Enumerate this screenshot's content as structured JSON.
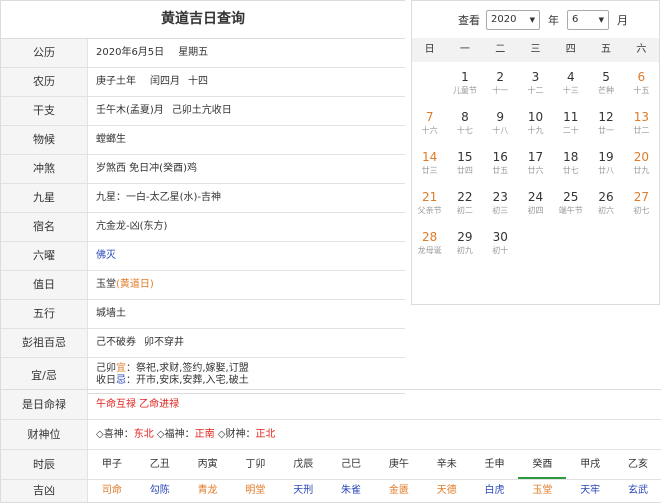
{
  "title": "黄道吉日查询",
  "rows": [
    {
      "label": "公历",
      "parts": [
        "2020年6月5日",
        "星期五"
      ]
    },
    {
      "label": "农历",
      "parts": [
        "庚子土年",
        "闰四月",
        "十四"
      ]
    },
    {
      "label": "干支",
      "parts": [
        "壬午木(孟夏)月",
        "己卯土亢收日"
      ]
    },
    {
      "label": "物候",
      "parts": [
        "螳螂生"
      ]
    },
    {
      "label": "冲煞",
      "parts": [
        "岁煞西 免日冲(癸酉)鸡"
      ]
    },
    {
      "label": "九星",
      "parts": [
        "九星：一白-太乙星(水)-吉神"
      ]
    },
    {
      "label": "宿名",
      "parts": [
        "亢金龙-凶(东方)"
      ]
    },
    {
      "label": "六曜",
      "parts": [
        "佛灭"
      ]
    },
    {
      "label": "值日",
      "parts": [
        "玉堂",
        "(黄道日)"
      ]
    },
    {
      "label": "五行",
      "parts": [
        "城墙土"
      ]
    },
    {
      "label": "彭祖百忌",
      "parts": [
        "己不破券",
        "卯不穿井"
      ]
    }
  ],
  "yiji": {
    "label": "宜/忌",
    "yi_prefix": "己卯",
    "yi_char": "宜",
    "yi_text": "：祭祀,求财,签约,嫁娶,订盟",
    "ji_prefix": "收日",
    "ji_char": "忌",
    "ji_text": "：开市,安床,安葬,入宅,破土"
  },
  "mingl": {
    "label": "是日命禄",
    "text": "午命互禄 乙命进禄"
  },
  "caishen": {
    "label": "财神位",
    "xi_label": "◇喜神：",
    "xi_value": "东北",
    "fu_label": "◇福神：",
    "fu_value": "正南",
    "cai_label": "◇财神：",
    "cai_value": "正北"
  },
  "shichen": {
    "label": "时辰",
    "items": [
      "甲子",
      "乙丑",
      "丙寅",
      "丁卯",
      "戊辰",
      "己巳",
      "庚午",
      "辛未",
      "壬申",
      "癸酉",
      "甲戌",
      "乙亥"
    ]
  },
  "jixiong": {
    "label": "吉凶",
    "items": [
      {
        "text": "司命",
        "color": "#e07b27"
      },
      {
        "text": "勾陈",
        "color": "#2a47b9"
      },
      {
        "text": "青龙",
        "color": "#e07b27"
      },
      {
        "text": "明堂",
        "color": "#e07b27"
      },
      {
        "text": "天刑",
        "color": "#2a47b9"
      },
      {
        "text": "朱雀",
        "color": "#2a47b9"
      },
      {
        "text": "金匮",
        "color": "#e07b27"
      },
      {
        "text": "天德",
        "color": "#e07b27"
      },
      {
        "text": "白虎",
        "color": "#2a47b9"
      },
      {
        "text": "玉堂",
        "color": "#e07b27"
      },
      {
        "text": "天牢",
        "color": "#2a47b9"
      },
      {
        "text": "玄武",
        "color": "#2a47b9"
      }
    ]
  },
  "calendar": {
    "year_label": "查看",
    "year_value": "2020",
    "year_suffix": "年",
    "month_value": "6",
    "month_suffix": "月",
    "weekdays": [
      "日",
      "一",
      "二",
      "三",
      "四",
      "五",
      "六"
    ],
    "days": [
      {
        "n": "",
        "l": ""
      },
      {
        "n": "1",
        "l": "儿童节"
      },
      {
        "n": "2",
        "l": "十一"
      },
      {
        "n": "3",
        "l": "十二"
      },
      {
        "n": "4",
        "l": "十三"
      },
      {
        "n": "5",
        "l": "芒种"
      },
      {
        "n": "6",
        "l": "十五"
      },
      {
        "n": "7",
        "l": "十六"
      },
      {
        "n": "8",
        "l": "十七"
      },
      {
        "n": "9",
        "l": "十八"
      },
      {
        "n": "10",
        "l": "十九"
      },
      {
        "n": "11",
        "l": "二十"
      },
      {
        "n": "12",
        "l": "廿一"
      },
      {
        "n": "13",
        "l": "廿二"
      },
      {
        "n": "14",
        "l": "廿三"
      },
      {
        "n": "15",
        "l": "廿四"
      },
      {
        "n": "16",
        "l": "廿五"
      },
      {
        "n": "17",
        "l": "廿六"
      },
      {
        "n": "18",
        "l": "廿七"
      },
      {
        "n": "19",
        "l": "廿八"
      },
      {
        "n": "20",
        "l": "廿九"
      },
      {
        "n": "21",
        "l": "父亲节"
      },
      {
        "n": "22",
        "l": "初二"
      },
      {
        "n": "23",
        "l": "初三"
      },
      {
        "n": "24",
        "l": "初四"
      },
      {
        "n": "25",
        "l": "端午节"
      },
      {
        "n": "26",
        "l": "初六"
      },
      {
        "n": "27",
        "l": "初七"
      },
      {
        "n": "28",
        "l": "龙母诞"
      },
      {
        "n": "29",
        "l": "初九"
      },
      {
        "n": "30",
        "l": "初十"
      }
    ]
  },
  "colors": {
    "blue": "#2a47b9",
    "orange": "#e07b27",
    "red": "#e0211c"
  }
}
